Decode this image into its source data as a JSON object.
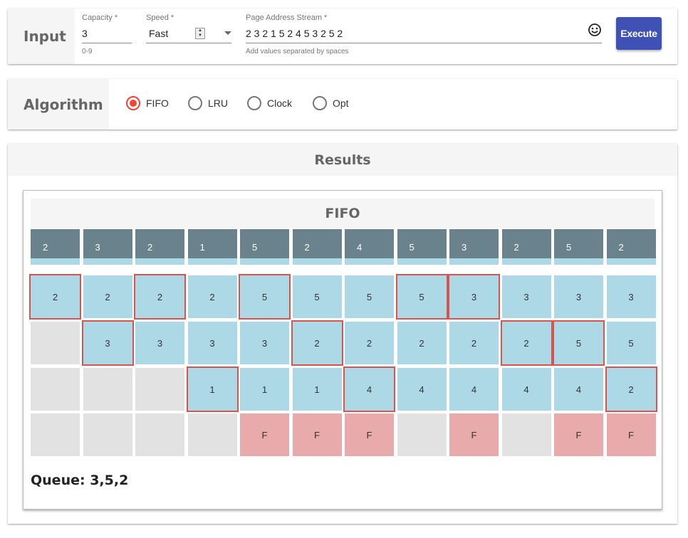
{
  "input": {
    "section_label": "Input",
    "capacity": {
      "label": "Capacity *",
      "value": "3",
      "hint": "0-9"
    },
    "speed": {
      "label": "Speed *",
      "value": "Fast"
    },
    "stream": {
      "label": "Page Address Stream *",
      "value": "2 3 2 1 5 2 4 5 3 2 5 2",
      "hint": "Add values separated by spaces"
    },
    "execute_label": "Execute"
  },
  "algorithm": {
    "section_label": "Algorithm",
    "options": [
      "FIFO",
      "LRU",
      "Clock",
      "Opt"
    ],
    "selected": "FIFO"
  },
  "results": {
    "header": "Results",
    "title": "FIFO",
    "stream": [
      "2",
      "3",
      "2",
      "1",
      "5",
      "2",
      "4",
      "5",
      "3",
      "2",
      "5",
      "2"
    ],
    "frames": [
      [
        "2",
        "2",
        "2",
        "2",
        "5",
        "5",
        "5",
        "5",
        "3",
        "3",
        "3",
        "3"
      ],
      [
        "",
        "3",
        "3",
        "3",
        "3",
        "2",
        "2",
        "2",
        "2",
        "2",
        "5",
        "5"
      ],
      [
        "",
        "",
        "",
        "1",
        "1",
        "1",
        "4",
        "4",
        "4",
        "4",
        "4",
        "2"
      ]
    ],
    "highlights": [
      [
        true,
        false,
        true,
        false,
        true,
        false,
        false,
        true,
        true,
        false,
        false,
        false
      ],
      [
        false,
        true,
        false,
        false,
        false,
        true,
        false,
        false,
        false,
        true,
        true,
        false
      ],
      [
        false,
        false,
        false,
        true,
        false,
        false,
        true,
        false,
        false,
        false,
        false,
        true
      ]
    ],
    "faults": [
      "",
      "",
      "",
      "",
      "F",
      "F",
      "F",
      "",
      "F",
      "",
      "F",
      "F"
    ],
    "queue": "Queue: 3,5,2"
  },
  "colors": {
    "accent": "#3f51b5",
    "radio_selected": "#f44336",
    "header_cell": "#6a828b",
    "frame_cell": "#add8e6",
    "empty_cell": "#e2e2e2",
    "fault_cell": "#e8aaaa",
    "highlight_border": "#d9534f"
  },
  "icons": {
    "emoji": "smiley-face-icon"
  }
}
